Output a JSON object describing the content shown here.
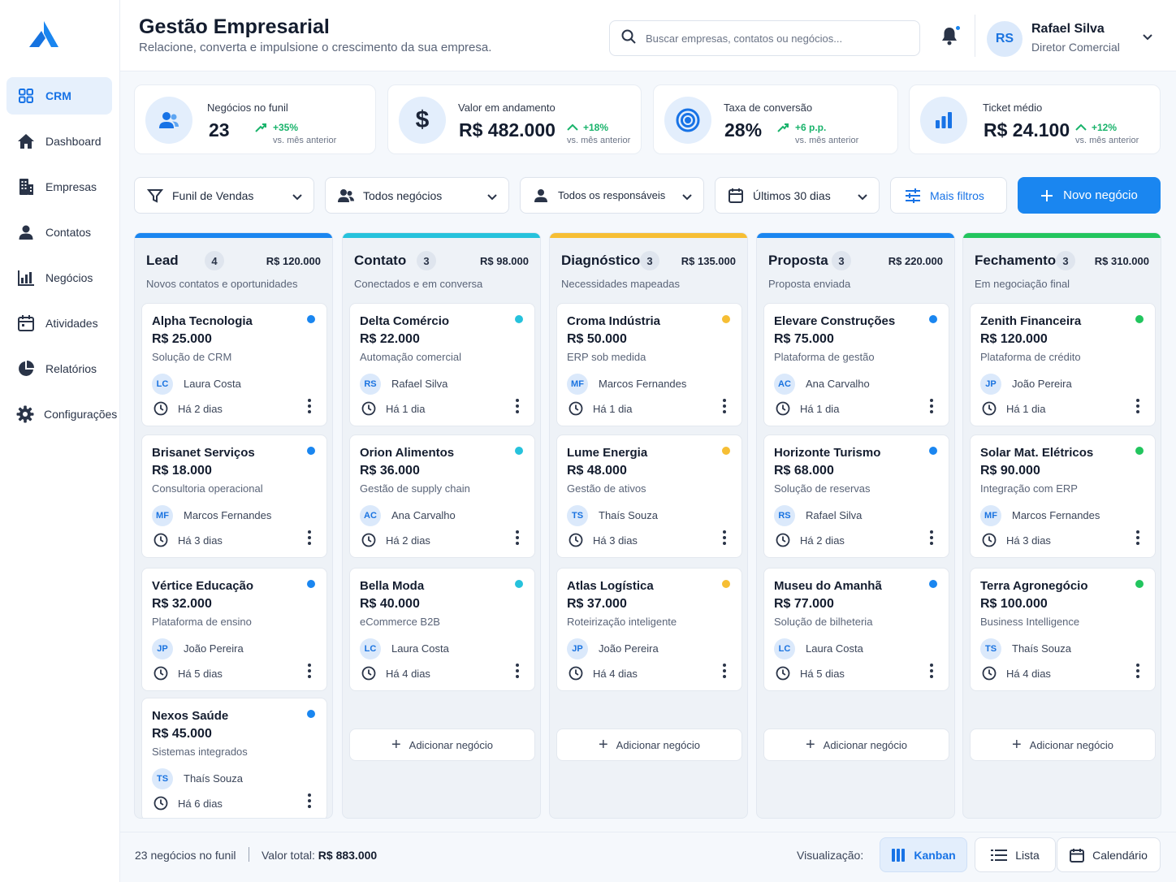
{
  "app": {
    "title": "Gestão Empresarial",
    "subtitle": "Relacione, converta e impulsione o crescimento da sua empresa."
  },
  "sidebar": {
    "items": [
      {
        "label": "CRM",
        "icon": "grid-icon",
        "active": true
      },
      {
        "label": "Dashboard",
        "icon": "home-icon"
      },
      {
        "label": "Empresas",
        "icon": "building-icon"
      },
      {
        "label": "Contatos",
        "icon": "person-icon"
      },
      {
        "label": "Negócios",
        "icon": "bar-chart-icon"
      },
      {
        "label": "Atividades",
        "icon": "calendar-icon"
      },
      {
        "label": "Relatórios",
        "icon": "pie-chart-icon"
      },
      {
        "label": "Configurações",
        "icon": "gear-icon"
      }
    ]
  },
  "header": {
    "search_placeholder": "Buscar empresas, contatos ou negócios...",
    "user_initials": "RS",
    "user_name": "Rafael Silva",
    "user_role": "Diretor Comercial"
  },
  "kpis": [
    {
      "label": "Negócios no funil",
      "value": "23",
      "delta": "+35%",
      "compare": "vs. mês anterior",
      "icon": "users-icon"
    },
    {
      "label": "Valor em andamento",
      "value": "R$ 482.000",
      "delta": "+18%",
      "compare": "vs. mês anterior",
      "icon": "dollar-icon"
    },
    {
      "label": "Taxa de conversão",
      "value": "28%",
      "delta": "+6 p.p.",
      "compare": "vs. mês anterior",
      "icon": "target-icon"
    },
    {
      "label": "Ticket médio",
      "value": "R$ 24.100",
      "delta": "+12%",
      "compare": "vs. mês anterior",
      "icon": "bar-chart-icon"
    }
  ],
  "filters": {
    "pipeline": "Funil de Vendas",
    "deals": "Todos negócios",
    "owners": "Todos os responsáveis",
    "period": "Últimos 30 dias",
    "more": "Mais filtros",
    "new_deal": "Novo negócio"
  },
  "colors": {
    "accent": "#1a86f0",
    "lead": "#1a86f0",
    "contato": "#26c2dc",
    "diagnostico": "#f6be34",
    "proposta": "#1a86f0",
    "fechamento": "#22c55e",
    "positive": "#19b36b"
  },
  "columns": [
    {
      "title": "Lead",
      "count": "4",
      "total": "R$ 120.000",
      "subtitle": "Novos contatos e oportunidades",
      "color": "#1a86f0",
      "cards": [
        {
          "name": "Alpha Tecnologia",
          "value": "R$ 25.000",
          "desc": "Solução de CRM",
          "initials": "LC",
          "owner": "Laura Costa",
          "time": "Há 2 dias"
        },
        {
          "name": "Brisanet Serviços",
          "value": "R$ 18.000",
          "desc": "Consultoria operacional",
          "initials": "MF",
          "owner": "Marcos Fernandes",
          "time": "Há 3 dias"
        },
        {
          "name": "Vértice Educação",
          "value": "R$ 32.000",
          "desc": "Plataforma de ensino",
          "initials": "JP",
          "owner": "João Pereira",
          "time": "Há 5 dias"
        },
        {
          "name": "Nexos Saúde",
          "value": "R$ 45.000",
          "desc": "Sistemas integrados",
          "initials": "TS",
          "owner": "Thaís Souza",
          "time": "Há 6 dias"
        }
      ],
      "add_label": ""
    },
    {
      "title": "Contato",
      "count": "3",
      "total": "R$ 98.000",
      "subtitle": "Conectados e em conversa",
      "color": "#26c2dc",
      "cards": [
        {
          "name": "Delta Comércio",
          "value": "R$ 22.000",
          "desc": "Automação comercial",
          "initials": "RS",
          "owner": "Rafael Silva",
          "time": "Há 1 dia"
        },
        {
          "name": "Orion Alimentos",
          "value": "R$ 36.000",
          "desc": "Gestão de supply chain",
          "initials": "AC",
          "owner": "Ana Carvalho",
          "time": "Há 2 dias"
        },
        {
          "name": "Bella Moda",
          "value": "R$ 40.000",
          "desc": "eCommerce B2B",
          "initials": "LC",
          "owner": "Laura Costa",
          "time": "Há 4 dias"
        }
      ],
      "add_label": "Adicionar negócio"
    },
    {
      "title": "Diagnóstico",
      "count": "3",
      "total": "R$ 135.000",
      "subtitle": "Necessidades mapeadas",
      "color": "#f6be34",
      "cards": [
        {
          "name": "Croma Indústria",
          "value": "R$ 50.000",
          "desc": "ERP sob medida",
          "initials": "MF",
          "owner": "Marcos Fernandes",
          "time": "Há 1 dia"
        },
        {
          "name": "Lume Energia",
          "value": "R$ 48.000",
          "desc": "Gestão de ativos",
          "initials": "TS",
          "owner": "Thaís Souza",
          "time": "Há 3 dias"
        },
        {
          "name": "Atlas Logística",
          "value": "R$ 37.000",
          "desc": "Roteirização inteligente",
          "initials": "JP",
          "owner": "João Pereira",
          "time": "Há 4 dias"
        }
      ],
      "add_label": "Adicionar negócio"
    },
    {
      "title": "Proposta",
      "count": "3",
      "total": "R$ 220.000",
      "subtitle": "Proposta enviada",
      "color": "#1a86f0",
      "cards": [
        {
          "name": "Elevare Construções",
          "value": "R$ 75.000",
          "desc": "Plataforma de gestão",
          "initials": "AC",
          "owner": "Ana Carvalho",
          "time": "Há 1 dia"
        },
        {
          "name": "Horizonte Turismo",
          "value": "R$ 68.000",
          "desc": "Solução de reservas",
          "initials": "RS",
          "owner": "Rafael Silva",
          "time": "Há 2 dias"
        },
        {
          "name": "Museu do Amanhã",
          "value": "R$ 77.000",
          "desc": "Solução de bilheteria",
          "initials": "LC",
          "owner": "Laura Costa",
          "time": "Há 5 dias"
        }
      ],
      "add_label": "Adicionar negócio"
    },
    {
      "title": "Fechamento",
      "count": "3",
      "total": "R$ 310.000",
      "subtitle": "Em negociação final",
      "color": "#22c55e",
      "cards": [
        {
          "name": "Zenith Financeira",
          "value": "R$ 120.000",
          "desc": "Plataforma de crédito",
          "initials": "JP",
          "owner": "João Pereira",
          "time": "Há 1 dia"
        },
        {
          "name": "Solar Mat. Elétricos",
          "value": "R$ 90.000",
          "desc": "Integração com ERP",
          "initials": "MF",
          "owner": "Marcos Fernandes",
          "time": "Há 3 dias"
        },
        {
          "name": "Terra Agronegócio",
          "value": "R$ 100.000",
          "desc": "Business Intelligence",
          "initials": "TS",
          "owner": "Thaís Souza",
          "time": "Há 4 dias"
        }
      ],
      "add_label": "Adicionar negócio"
    }
  ],
  "footer": {
    "count": "23 negócios no funil",
    "total_label": "Valor total:",
    "total_value": "R$ 883.000",
    "view_label": "Visualização:",
    "views": [
      "Kanban",
      "Lista",
      "Calendário"
    ],
    "active_view": "Kanban"
  }
}
